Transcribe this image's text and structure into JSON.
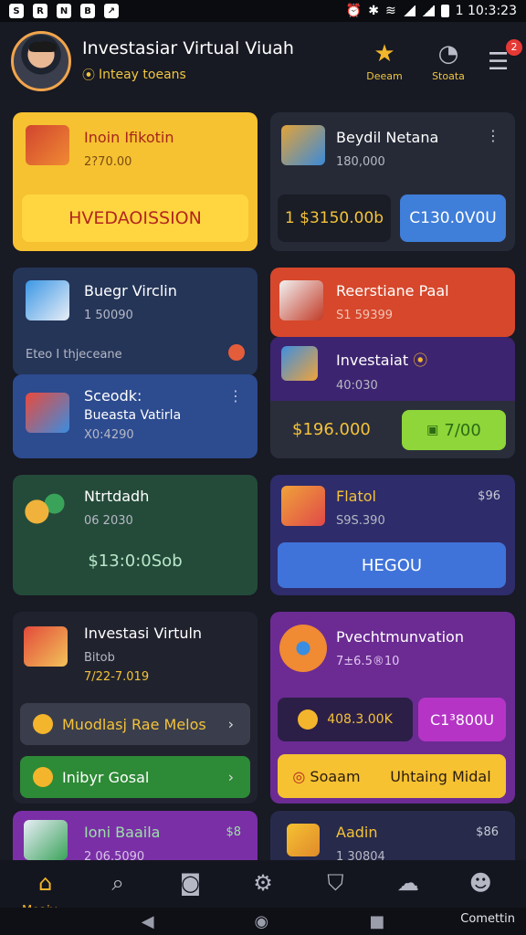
{
  "status_bar": {
    "time": "1 10:3:23"
  },
  "header": {
    "title": "Investasiar Virtual Viuah",
    "subtitle": "Inteay toeans",
    "subtitle_icon": "coin-icon",
    "actions": [
      {
        "label": "Deeam",
        "icon": "star-icon"
      },
      {
        "label": "Stoata",
        "icon": "chart-icon"
      }
    ],
    "notification_count": "2"
  },
  "cards": {
    "c1": {
      "title": "Inoin Ifikotin",
      "sub": "2?70.00",
      "button": "HVEDAOISSION"
    },
    "c2": {
      "title": "Beydil Netana",
      "sub": "180,000",
      "value": "1 $3150.00b",
      "button": "C130.0V0U"
    },
    "c3": {
      "title": "Buegr Virclin",
      "sub": "1 50090",
      "footer": "Eteo I thjeceane"
    },
    "c4": {
      "title": "Reerstiane Paal",
      "sub": "S1 59399"
    },
    "c5": {
      "title": "Sceodk:",
      "title2": "Bueasta Vatirla",
      "sub": "X0:4290"
    },
    "c6": {
      "title": "Investaiat",
      "sub": "40:030",
      "value": "$196.000",
      "button": "7/00"
    },
    "c7": {
      "title": "Ntrtdadh",
      "sub": "06 2030",
      "value": "$13:0:0Sob"
    },
    "c8": {
      "title": "Flatol",
      "sub": "S9S.390",
      "corner": "$96",
      "button": "HEGOU"
    },
    "c9": {
      "title": "Investasi Virtuln",
      "sub1": "Bitob",
      "sub2": "7/22-7.019"
    },
    "c9a": {
      "label": "Muodlasj Rae Melos"
    },
    "c9b": {
      "label": "Inibyr Gosal"
    },
    "c10": {
      "title": "Pvechtmunvation",
      "sub": "7±6.5®10",
      "value": "408.3.00K",
      "button": "C1³800U"
    },
    "c10a": {
      "label1": "Soaam",
      "label2": "Uhtaing Midal"
    },
    "c11": {
      "title": "Ioni Baaila",
      "sub": "2 06.5090",
      "corner": "$8"
    },
    "c12": {
      "title": "Aadin",
      "sub": "1 30804",
      "corner": "$86"
    }
  },
  "nav": {
    "items": [
      {
        "label": "Moaiv",
        "icon": "home-icon"
      },
      {
        "label": "",
        "icon": "search-icon"
      },
      {
        "label": "",
        "icon": "camera-icon"
      },
      {
        "label": "",
        "icon": "settings-icon"
      },
      {
        "label": "",
        "icon": "shield-icon"
      },
      {
        "label": "",
        "icon": "handshake-icon"
      },
      {
        "label": "Comettin",
        "icon": "group-icon"
      }
    ]
  },
  "colors": {
    "accent": "#f3b52b",
    "green": "#29a744",
    "purple": "#8e2bb8",
    "blue": "#3f73d9"
  }
}
